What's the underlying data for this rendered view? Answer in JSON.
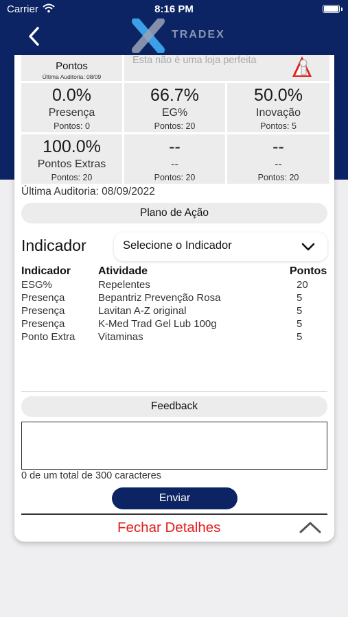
{
  "status_bar": {
    "carrier": "Carrier",
    "time": "8:16 PM"
  },
  "header": {
    "brand": "TRADEX",
    "back_icon": "chevron-left-icon",
    "logo_icon": "x-logo-icon"
  },
  "colors": {
    "navy": "#0c2463",
    "red": "#e11d1d",
    "tile_gray": "#ececec"
  },
  "score_partial": {
    "label": "Pontos",
    "audit": "Última Auditoria: 08/09"
  },
  "store_banner": {
    "text": "Esta não é uma loja perfeita"
  },
  "tiles": [
    {
      "value": "0.0%",
      "label": "Presença",
      "points": "Pontos: 0"
    },
    {
      "value": "66.7%",
      "label": "EG%",
      "points": "Pontos: 20"
    },
    {
      "value": "50.0%",
      "label": "Inovação",
      "points": "Pontos: 5"
    },
    {
      "value": "100.0%",
      "label": "Pontos  Extras",
      "points": "Pontos: 20"
    },
    {
      "value": "--",
      "label": "--",
      "points": "Pontos: 20"
    },
    {
      "value": "--",
      "label": "--",
      "points": "Pontos: 20"
    }
  ],
  "last_audit": "Última Auditoria: 08/09/2022",
  "action_plan_button": "Plano de Ação",
  "indicator": {
    "title": "Indicador",
    "select_value": "Selecione o Indicador",
    "headers": {
      "indicator": "Indicador",
      "activity": "Atividade",
      "points": "Pontos"
    },
    "rows": [
      {
        "indicator": "ESG%",
        "activity": "Repelentes",
        "points": "20"
      },
      {
        "indicator": "Presença",
        "activity": "Bepantriz Prevenção Rosa",
        "points": "5"
      },
      {
        "indicator": "Presença",
        "activity": "Lavitan A-Z original",
        "points": "5"
      },
      {
        "indicator": "Presença",
        "activity": "K-Med Trad Gel Lub 100g",
        "points": "5"
      },
      {
        "indicator": "Ponto Extra",
        "activity": "Vitaminas",
        "points": "5"
      }
    ]
  },
  "feedback": {
    "button": "Feedback",
    "text_value": "",
    "counter": "0 de um total de 300 caracteres",
    "send_button": "Enviar"
  },
  "close_details": "Fechar Detalhes"
}
